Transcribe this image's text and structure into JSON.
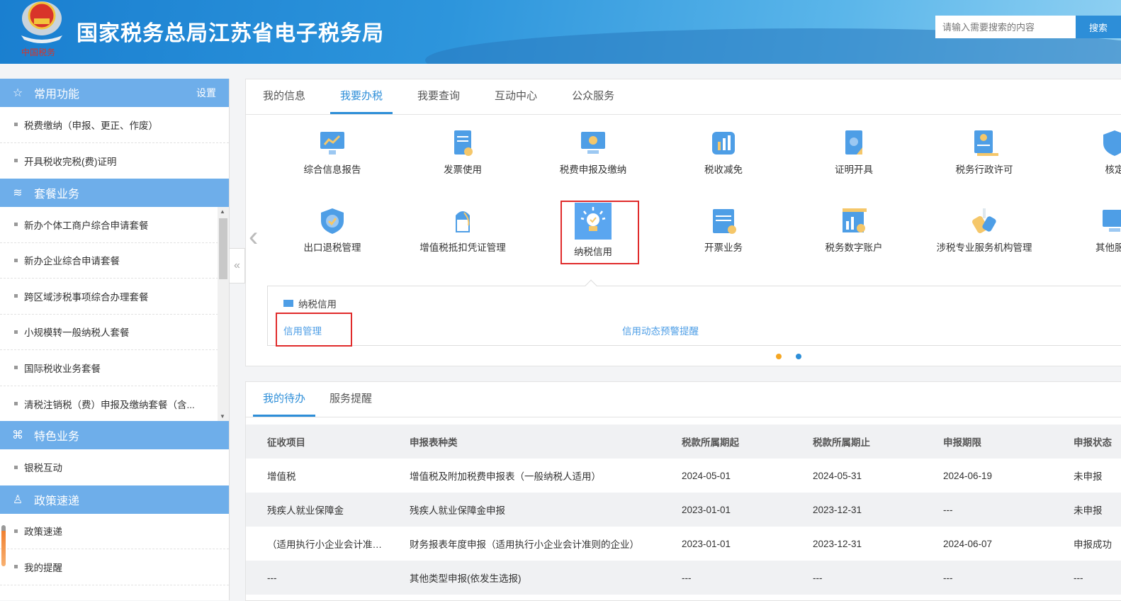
{
  "header": {
    "title": "国家税务总局江苏省电子税务局",
    "logo_text": "中国税务",
    "search_placeholder": "请输入需要搜索的内容",
    "search_button": "搜索"
  },
  "sidebar": {
    "sections": [
      {
        "title": "常用功能",
        "icon": "star-icon",
        "action": "设置",
        "items": [
          "税费缴纳（申报、更正、作废）",
          "开具税收完税(费)证明"
        ]
      },
      {
        "title": "套餐业务",
        "icon": "layers-icon",
        "items": [
          "新办个体工商户综合申请套餐",
          "新办企业综合申请套餐",
          "跨区域涉税事项综合办理套餐",
          "小规模转一般纳税人套餐",
          "国际税收业务套餐",
          "清税注销税（费）申报及缴纳套餐（含..."
        ]
      },
      {
        "title": "特色业务",
        "icon": "command-icon",
        "items": [
          "银税互动"
        ]
      },
      {
        "title": "政策速递",
        "icon": "user-plus-icon",
        "items": [
          "政策速递",
          "我的提醒"
        ]
      }
    ]
  },
  "main": {
    "tabs": [
      "我的信息",
      "我要办税",
      "我要查询",
      "互动中心",
      "公众服务"
    ],
    "active_tab": 1,
    "row1": [
      "综合信息报告",
      "发票使用",
      "税费申报及缴纳",
      "税收减免",
      "证明开具",
      "税务行政许可",
      "核定"
    ],
    "row2": [
      "出口退税管理",
      "增值税抵扣凭证管理",
      "纳税信用",
      "开票业务",
      "税务数字账户",
      "涉税专业服务机构管理",
      "其他服务"
    ],
    "detail": {
      "title": "纳税信用",
      "links": [
        "信用管理",
        "信用动态预警提醒"
      ]
    },
    "dot_colors": [
      "#f5a623",
      "#2d8ed8"
    ]
  },
  "todo": {
    "tabs": [
      "我的待办",
      "服务提醒"
    ],
    "columns": [
      "征收项目",
      "申报表种类",
      "税款所属期起",
      "税款所属期止",
      "申报期限",
      "申报状态"
    ],
    "rows": [
      [
        "增值税",
        "增值税及附加税费申报表（一般纳税人适用）",
        "2024-05-01",
        "2024-05-31",
        "2024-06-19",
        "未申报"
      ],
      [
        "残疾人就业保障金",
        "残疾人就业保障金申报",
        "2023-01-01",
        "2023-12-31",
        "---",
        "未申报"
      ],
      [
        "（适用执行小企业会计准则...",
        "财务报表年度申报（适用执行小企业会计准则的企业）",
        "2023-01-01",
        "2023-12-31",
        "2024-06-07",
        "申报成功"
      ],
      [
        "---",
        "其他类型申报(依发生选报)",
        "---",
        "---",
        "---",
        "---"
      ]
    ]
  }
}
